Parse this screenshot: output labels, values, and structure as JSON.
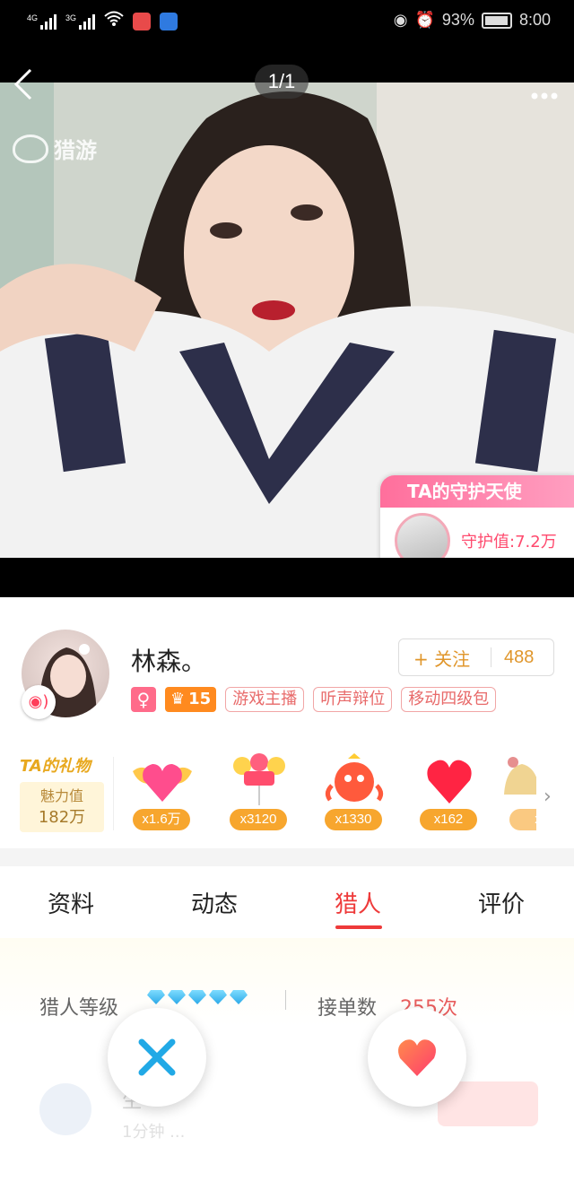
{
  "status_bar": {
    "net1": "4G",
    "net2": "3G",
    "battery_pct": "93%",
    "time": "8:00"
  },
  "media": {
    "counter": "1/1",
    "watermark": "猎游",
    "guardian": {
      "title": "TA的守护天使",
      "value": "守护值:7.2万"
    }
  },
  "profile": {
    "nickname": "林森。",
    "follow_label": "+ 关注",
    "follow_count": "488",
    "gender_symbol": "♀",
    "level": "15",
    "tags": [
      "游戏主播",
      "听声辩位",
      "移动四级包"
    ]
  },
  "gifts": {
    "title": "TA的礼物",
    "charm_label": "魅力值",
    "charm_value": "182万",
    "items": [
      {
        "name": "winged-heart",
        "count": "x1.6万"
      },
      {
        "name": "love-balloons",
        "count": "x3120"
      },
      {
        "name": "dragon-mascot",
        "count": "x1330"
      },
      {
        "name": "heart",
        "count": "x162"
      },
      {
        "name": "bell",
        "count": "x"
      }
    ]
  },
  "tabs": [
    {
      "label": "资料"
    },
    {
      "label": "动态"
    },
    {
      "label": "猎人",
      "active": true
    },
    {
      "label": "评价"
    }
  ],
  "detail": {
    "hunter_level_label": "猎人等级",
    "hunter_level_gems": 5,
    "orders_label": "接单数",
    "orders_value": "255次",
    "faded_text1": "生",
    "faded_text2": "1分钟  ..."
  },
  "colors": {
    "accent": "#ee3a3a",
    "follow": "#e0962b",
    "guardian": "#ff6f9c",
    "gift_badge": "#f7a62e"
  }
}
